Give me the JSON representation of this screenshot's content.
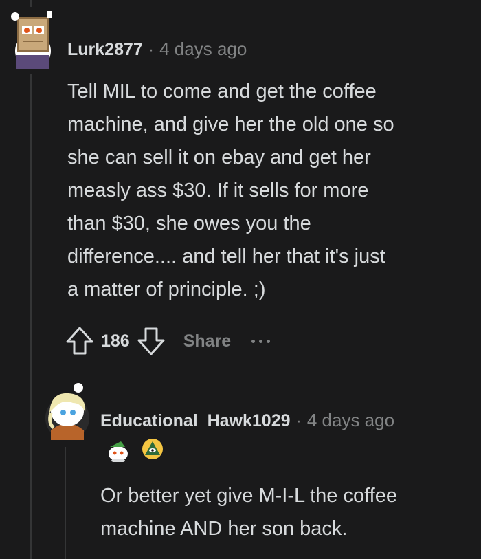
{
  "comments": [
    {
      "username": "Lurk2877",
      "separator": "·",
      "time": "4 days ago",
      "avatar_icon": "snoo-box-head-avatar",
      "body_lines": [
        "Tell MIL to come and get the coffee",
        "machine, and give her the old one so",
        "she can sell it on ebay and get her",
        "measly ass $30. If it sells for more",
        "than $30, she owes you the",
        "difference.... and tell her that it's just",
        "a matter of principle. ;)"
      ],
      "score": "186",
      "share_label": "Share"
    },
    {
      "username": "Educational_Hawk1029",
      "separator": "·",
      "time": "4 days ago",
      "avatar_icon": "snoo-blonde-hair-avatar",
      "awards": [
        "snoo-award-icon",
        "pyramid-eye-award-icon"
      ],
      "body_lines": [
        "Or better yet give M-I-L the coffee",
        "machine AND her son back."
      ]
    }
  ],
  "colors": {
    "background": "#1a1a1b",
    "text": "#d7dadc",
    "muted": "#818384",
    "thread_line": "#343536"
  }
}
